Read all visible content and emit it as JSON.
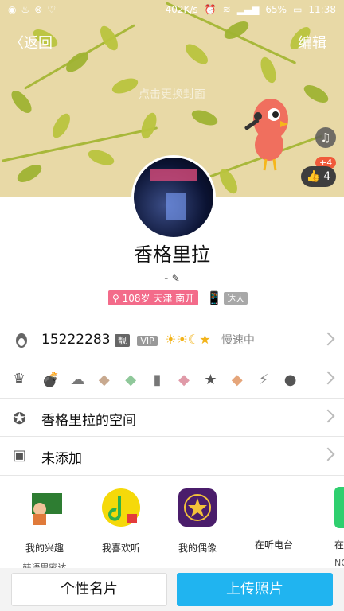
{
  "status_bar": {
    "speed": "402K/s",
    "battery": "65%",
    "time": "11:38"
  },
  "header": {
    "back_label": "返回",
    "edit_label": "编辑",
    "cover_hint": "点击更换封面",
    "like_count": "4",
    "like_plus": "+4"
  },
  "profile": {
    "name": "香格里拉",
    "signature": "-",
    "tag_info": "108岁 天津 南开",
    "daren_label": "达人"
  },
  "rows": {
    "qq_number": "15222283",
    "vip_badge_1": "靓",
    "vip_badge_2": "VIP",
    "speed_label": "慢速中",
    "space_label": "香格里拉的空间",
    "unadded_label": "未添加"
  },
  "apps": [
    {
      "label": "我的兴趣",
      "sub": "韩语思密达"
    },
    {
      "label": "我喜欢听",
      "sub": ""
    },
    {
      "label": "我的偶像",
      "sub": ""
    },
    {
      "label": "在听电台",
      "sub": ""
    },
    {
      "label": "在",
      "sub": "NO"
    }
  ],
  "buttons": {
    "card_label": "个性名片",
    "upload_label": "上传照片"
  },
  "colors": {
    "accent_blue": "#20b4f0",
    "tag_pink": "#f36b8a",
    "cover_bg": "#e8d9a6"
  }
}
